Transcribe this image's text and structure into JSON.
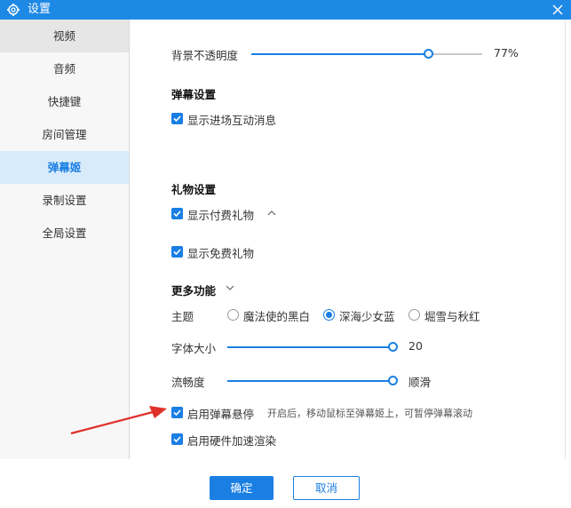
{
  "window": {
    "title": "设置"
  },
  "sidebar": {
    "items": [
      {
        "label": "视频"
      },
      {
        "label": "音频"
      },
      {
        "label": "快捷键"
      },
      {
        "label": "房间管理"
      },
      {
        "label": "弹幕姬"
      },
      {
        "label": "录制设置"
      },
      {
        "label": "全局设置"
      }
    ],
    "active_index": 4
  },
  "settings": {
    "opacity": {
      "label": "背景不透明度",
      "value_text": "77%",
      "value": 0.77
    },
    "danmaku_section": {
      "title": "弹幕设置",
      "show_entry_interaction": {
        "label": "显示进场互动消息",
        "checked": true
      }
    },
    "gift_section": {
      "title": "礼物设置",
      "show_paid_gifts": {
        "label": "显示付费礼物",
        "checked": true
      },
      "show_free_gifts": {
        "label": "显示免费礼物",
        "checked": true
      }
    },
    "more_section": {
      "title": "更多功能",
      "theme": {
        "label": "主题",
        "options": [
          {
            "label": "魔法使的黑白",
            "selected": false
          },
          {
            "label": "深海少女蓝",
            "selected": true
          },
          {
            "label": "堀雪与秋红",
            "selected": false
          }
        ]
      },
      "font_size": {
        "label": "字体大小",
        "value_text": "20",
        "value": 1.0
      },
      "smoothness": {
        "label": "流畅度",
        "value_text": "顺滑",
        "value": 1.0
      },
      "hover_pause": {
        "label": "启用弹幕悬停",
        "hint": "开启后，移动鼠标至弹幕姬上，可暂停弹幕滚动",
        "checked": true
      },
      "hw_accel": {
        "label": "启用硬件加速渲染",
        "checked": true
      }
    }
  },
  "footer": {
    "ok_label": "确定",
    "cancel_label": "取消"
  },
  "colors": {
    "accent": "#1a7fe3",
    "titlebar": "#1e88e5",
    "annotation_arrow": "#e0302a"
  }
}
